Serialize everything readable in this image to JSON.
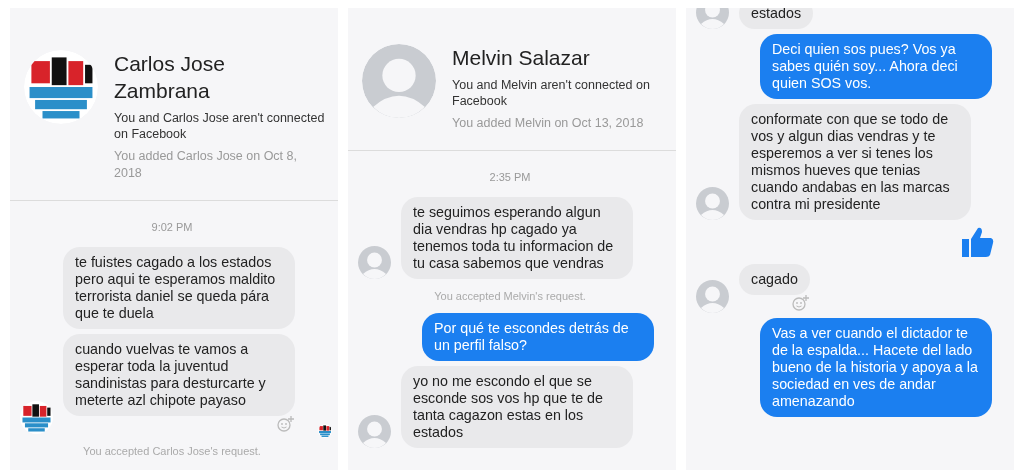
{
  "panels": [
    {
      "header": {
        "name": "Carlos Jose Zambrana",
        "connection": "You and Carlos Jose aren't connected on Facebook",
        "added": "You added Carlos Jose on Oct 8, 2018"
      },
      "messages": [
        {
          "kind": "time",
          "text": "9:02 PM"
        },
        {
          "kind": "incoming",
          "text": "te fuistes cagado a los estados pero aqui te esperamos maldito terrorista daniel se queda pára que te duela",
          "show_avatar": false,
          "react_button": false,
          "seen": false
        },
        {
          "kind": "incoming",
          "text": "cuando vuelvas te vamos a esperar toda la juventud sandinistas para desturcarte y meterte azl chipote payaso",
          "show_avatar": true,
          "react_button": true,
          "seen": true
        },
        {
          "kind": "notice",
          "text": "You accepted Carlos Jose's request."
        }
      ]
    },
    {
      "header": {
        "avatar": {
          "kind": "placeholder"
        },
        "name": "Melvin Salazar",
        "connection": "You and Melvin aren't connected on Facebook",
        "added": "You added Melvin on Oct 13, 2018"
      },
      "messages": [
        {
          "kind": "time",
          "text": "2:35 PM"
        },
        {
          "kind": "incoming",
          "text": "te seguimos esperando algun dia vendras hp cagado ya tenemos toda tu informacion de tu casa sabemos que vendras",
          "show_avatar": true,
          "react_button": false,
          "seen": false
        },
        {
          "kind": "notice",
          "text": "You accepted Melvin's request."
        },
        {
          "kind": "outgoing",
          "text": "Por qué te escondes detrás de un perfil falso?"
        },
        {
          "kind": "incoming",
          "text": "yo no me escondo el que se esconde sos vos hp que te de tanta cagazon estas en los estados",
          "show_avatar": true,
          "react_button": false,
          "seen": false
        }
      ]
    },
    {
      "messages": [
        {
          "kind": "incoming",
          "text": "estados",
          "show_avatar": true,
          "react_button": false,
          "seen": false
        },
        {
          "kind": "outgoing",
          "text": "Deci quien sos pues? Vos ya sabes quién soy... Ahora deci quien SOS vos."
        },
        {
          "kind": "incoming",
          "text": "conformate con que se todo de vos y algun dias vendras y te esperemos a ver si tenes los mismos hueves que tenias cuando andabas en las marcas contra mi presidente",
          "show_avatar": true,
          "react_button": false,
          "seen": false
        },
        {
          "kind": "like"
        },
        {
          "kind": "incoming",
          "text": "cagado",
          "show_avatar": true,
          "react_button": true,
          "seen": false
        },
        {
          "kind": "outgoing",
          "text": "Vas a ver cuando el dictador te de la espalda... Hacete del lado bueno de la historia y apoya a la sociedad en ves de andar amenazando"
        }
      ]
    }
  ]
}
